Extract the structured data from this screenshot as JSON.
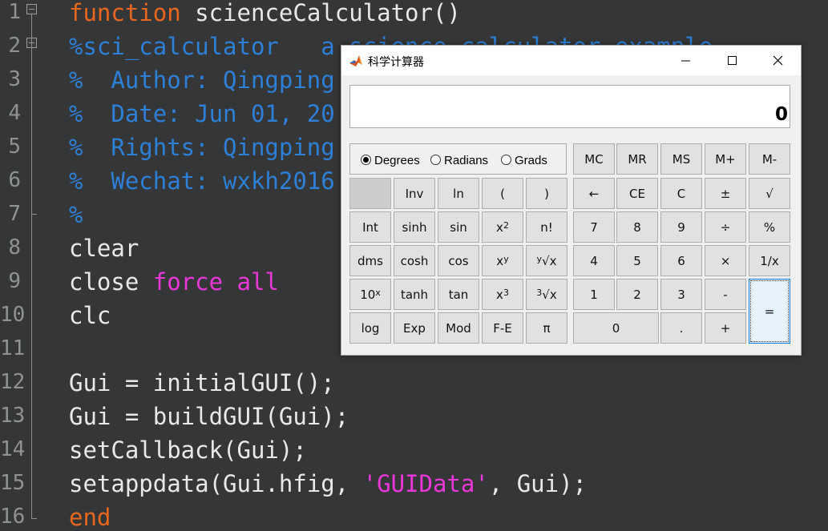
{
  "editor": {
    "line_numbers": [
      "1",
      "2",
      "3",
      "4",
      "5",
      "6",
      "7",
      "8",
      "9",
      "10",
      "11",
      "12",
      "13",
      "14",
      "15",
      "16"
    ],
    "lines": [
      [
        {
          "t": "function ",
          "c": "kw"
        },
        {
          "t": "scienceCalculator()",
          "c": ""
        }
      ],
      [
        {
          "t": "%sci_calculator   a science calculator example",
          "c": "cm"
        }
      ],
      [
        {
          "t": "%  Author: Qingping",
          "c": "cm"
        }
      ],
      [
        {
          "t": "%  Date: Jun 01, 20",
          "c": "cm"
        }
      ],
      [
        {
          "t": "%  Rights: Qingping",
          "c": "cm"
        }
      ],
      [
        {
          "t": "%  Wechat: wxkh2016",
          "c": "cm"
        }
      ],
      [
        {
          "t": "%",
          "c": "cm"
        }
      ],
      [
        {
          "t": "clear",
          "c": ""
        }
      ],
      [
        {
          "t": "close ",
          "c": ""
        },
        {
          "t": "force all",
          "c": "mg"
        }
      ],
      [
        {
          "t": "clc",
          "c": ""
        }
      ],
      [],
      [
        {
          "t": "Gui = initialGUI();",
          "c": ""
        }
      ],
      [
        {
          "t": "Gui = buildGUI(Gui);",
          "c": ""
        }
      ],
      [
        {
          "t": "setCallback(Gui);",
          "c": ""
        }
      ],
      [
        {
          "t": "setappdata(Gui.hfig, ",
          "c": ""
        },
        {
          "t": "'GUIData'",
          "c": "mg"
        },
        {
          "t": ", Gui);",
          "c": ""
        }
      ],
      [
        {
          "t": "end",
          "c": "kw"
        }
      ]
    ]
  },
  "colors": {
    "keyword": "#e8671e",
    "comment": "#2e7fd6",
    "string": "#ea37d8",
    "editor_bg": "#353637"
  },
  "calculator": {
    "window_title": "科学计算器",
    "icon": "matlab-icon",
    "window_controls": [
      "minimize-icon",
      "maximize-icon",
      "close-icon"
    ],
    "display_value": "0",
    "angle_units": [
      {
        "label": "Degrees",
        "selected": true
      },
      {
        "label": "Radians",
        "selected": false
      },
      {
        "label": "Grads",
        "selected": false
      }
    ],
    "sci_keys": [
      [
        "",
        "Inv",
        "ln",
        "(",
        ")"
      ],
      [
        "Int",
        "sinh",
        "sin",
        "x^2",
        "n!"
      ],
      [
        "dms",
        "cosh",
        "cos",
        "x^y",
        "y√x"
      ],
      [
        "10^x",
        "tanh",
        "tan",
        "x^3",
        "3√x"
      ],
      [
        "log",
        "Exp",
        "Mod",
        "F-E",
        "π"
      ]
    ],
    "memory_keys": [
      "MC",
      "MR",
      "MS",
      "M+",
      "M-"
    ],
    "std_keys": [
      [
        "←",
        "CE",
        "C",
        "±",
        "√"
      ],
      [
        "7",
        "8",
        "9",
        "÷",
        "%"
      ],
      [
        "4",
        "5",
        "6",
        "×",
        "1/x"
      ],
      [
        "1",
        "2",
        "3",
        "-",
        "="
      ],
      [
        "0",
        ".",
        "+"
      ]
    ]
  }
}
